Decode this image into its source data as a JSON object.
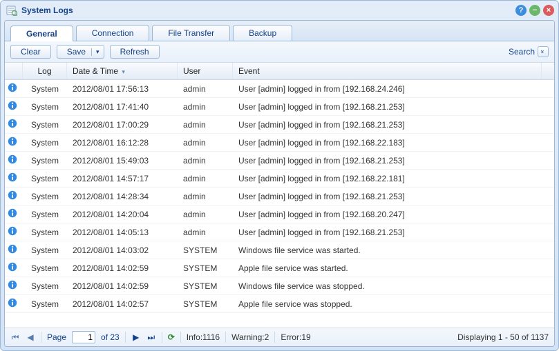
{
  "window": {
    "title": "System Logs"
  },
  "tabs": [
    {
      "label": "General",
      "active": true
    },
    {
      "label": "Connection",
      "active": false
    },
    {
      "label": "File Transfer",
      "active": false
    },
    {
      "label": "Backup",
      "active": false
    }
  ],
  "toolbar": {
    "clear_label": "Clear",
    "save_label": "Save",
    "refresh_label": "Refresh",
    "search_label": "Search"
  },
  "columns": {
    "icon": "",
    "log": "Log",
    "date": "Date & Time",
    "user": "User",
    "event": "Event"
  },
  "sort": {
    "column": "date",
    "dir": "desc"
  },
  "rows": [
    {
      "level": "info",
      "log": "System",
      "date": "2012/08/01 17:56:13",
      "user": "admin",
      "event": "User [admin] logged in from [192.168.24.246]"
    },
    {
      "level": "info",
      "log": "System",
      "date": "2012/08/01 17:41:40",
      "user": "admin",
      "event": "User [admin] logged in from [192.168.21.253]"
    },
    {
      "level": "info",
      "log": "System",
      "date": "2012/08/01 17:00:29",
      "user": "admin",
      "event": "User [admin] logged in from [192.168.21.253]"
    },
    {
      "level": "info",
      "log": "System",
      "date": "2012/08/01 16:12:28",
      "user": "admin",
      "event": "User [admin] logged in from [192.168.22.183]"
    },
    {
      "level": "info",
      "log": "System",
      "date": "2012/08/01 15:49:03",
      "user": "admin",
      "event": "User [admin] logged in from [192.168.21.253]"
    },
    {
      "level": "info",
      "log": "System",
      "date": "2012/08/01 14:57:17",
      "user": "admin",
      "event": "User [admin] logged in from [192.168.22.181]"
    },
    {
      "level": "info",
      "log": "System",
      "date": "2012/08/01 14:28:34",
      "user": "admin",
      "event": "User [admin] logged in from [192.168.21.253]"
    },
    {
      "level": "info",
      "log": "System",
      "date": "2012/08/01 14:20:04",
      "user": "admin",
      "event": "User [admin] logged in from [192.168.20.247]"
    },
    {
      "level": "info",
      "log": "System",
      "date": "2012/08/01 14:05:13",
      "user": "admin",
      "event": "User [admin] logged in from [192.168.21.253]"
    },
    {
      "level": "info",
      "log": "System",
      "date": "2012/08/01 14:03:02",
      "user": "SYSTEM",
      "event": "Windows file service was started."
    },
    {
      "level": "info",
      "log": "System",
      "date": "2012/08/01 14:02:59",
      "user": "SYSTEM",
      "event": "Apple file service was started."
    },
    {
      "level": "info",
      "log": "System",
      "date": "2012/08/01 14:02:59",
      "user": "SYSTEM",
      "event": "Windows file service was stopped."
    },
    {
      "level": "info",
      "log": "System",
      "date": "2012/08/01 14:02:57",
      "user": "SYSTEM",
      "event": "Apple file service was stopped."
    }
  ],
  "pager": {
    "page_value": "1",
    "page_label_pre": "Page",
    "page_label_post": "of 23",
    "info": "Info:1116",
    "warning": "Warning:2",
    "error": "Error:19",
    "summary": "Displaying 1 - 50 of 1137"
  }
}
